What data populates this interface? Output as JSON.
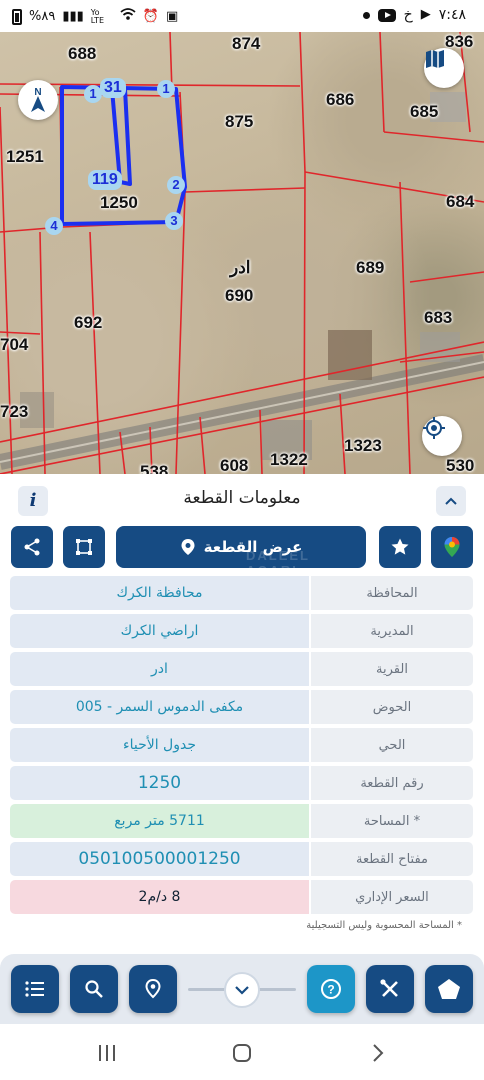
{
  "status_bar": {
    "time": "٧:٤٨",
    "battery": "%٨٩",
    "carrier_letter": "خ",
    "network": "Yo LTE"
  },
  "map": {
    "parcels": [
      "688",
      "874",
      "836",
      "686",
      "685",
      "875",
      "1251",
      "1250",
      "684",
      "689",
      "690",
      "692",
      "683",
      "704",
      "723",
      "1323",
      "1322",
      "608",
      "538",
      "530"
    ],
    "vertex_labels": [
      "1",
      "2",
      "3",
      "4",
      "31",
      "119",
      "1"
    ],
    "village_label": "ادر"
  },
  "sheet": {
    "title": "معلومات القطعة",
    "view_parcel_label": "عرض القطعة",
    "watermark": "DALEEL AQARI",
    "rows": [
      {
        "label": "المحافظة",
        "value": "محافظة الكرك"
      },
      {
        "label": "المديرية",
        "value": "اراضي الكرك"
      },
      {
        "label": "القرية",
        "value": "ادر"
      },
      {
        "label": "الحوض",
        "value": "مكفى الدموس السمر - 005"
      },
      {
        "label": "الحي",
        "value": "جدول الأحياء"
      },
      {
        "label": "رقم القطعة",
        "value": "1250"
      },
      {
        "label": "المساحة *",
        "value": "5711  متر مربع"
      },
      {
        "label": "مفتاح القطعة",
        "value": "050100500001250"
      },
      {
        "label": "السعر الإداري",
        "value": "8 د/م2"
      }
    ],
    "note": "* المساحة المحسوبة وليس التسجيلية"
  },
  "colors": {
    "primary": "#164b83",
    "accent": "#1d96c8",
    "parcel_line": "#e0262b",
    "selected_parcel": "#1b2ff0"
  }
}
